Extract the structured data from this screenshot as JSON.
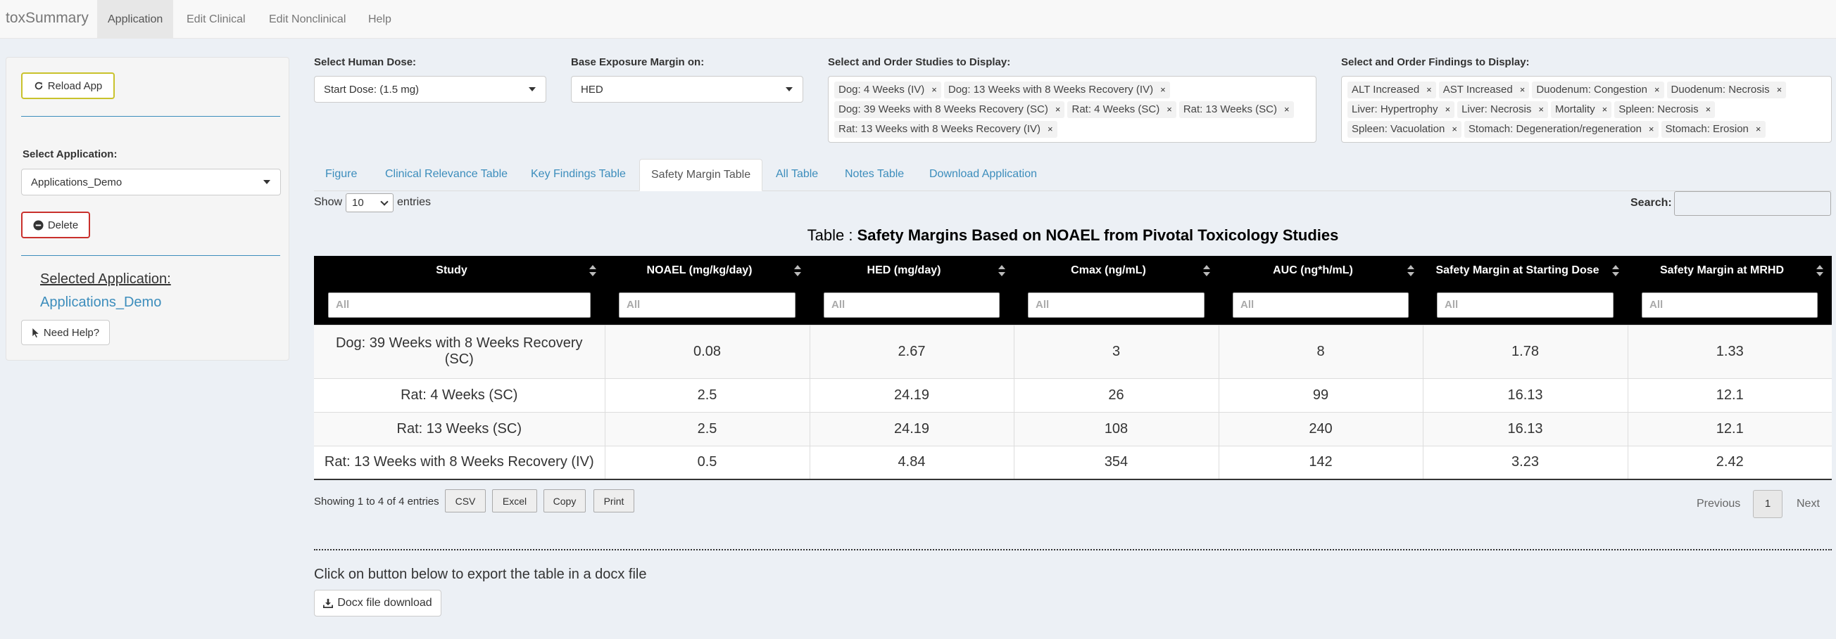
{
  "navbar": {
    "brand": "toxSummary",
    "items": [
      "Application",
      "Edit Clinical",
      "Edit Nonclinical",
      "Help"
    ]
  },
  "sidebar": {
    "reload_label": "Reload App",
    "select_application_label": "Select Application:",
    "application_value": "Applications_Demo",
    "delete_label": "Delete",
    "selected_title": "Selected Application:",
    "selected_value": "Applications_Demo",
    "help_label": "Need Help?"
  },
  "controls": {
    "human_dose_label": "Select Human Dose:",
    "human_dose_value": "Start Dose: (1.5 mg)",
    "base_label": "Base Exposure Margin on:",
    "base_value": "HED",
    "studies_label": "Select and Order Studies to Display:",
    "studies": [
      "Dog: 4 Weeks (IV)",
      "Dog: 13 Weeks with 8 Weeks Recovery (IV)",
      "Dog: 39 Weeks with 8 Weeks Recovery (SC)",
      "Rat: 4 Weeks (SC)",
      "Rat: 13 Weeks (SC)",
      "Rat: 13 Weeks with 8 Weeks Recovery (IV)"
    ],
    "findings_label": "Select and Order Findings to Display:",
    "findings": [
      "ALT Increased",
      "AST Increased",
      "Duodenum: Congestion",
      "Duodenum: Necrosis",
      "Liver: Hypertrophy",
      "Liver: Necrosis",
      "Mortality",
      "Spleen: Necrosis",
      "Spleen: Vacuolation",
      "Stomach: Degeneration/regeneration",
      "Stomach: Erosion"
    ]
  },
  "tabs": [
    "Figure",
    "Clinical Relevance Table",
    "Key Findings Table",
    "Safety Margin Table",
    "All Table",
    "Notes Table",
    "Download Application"
  ],
  "active_tab": "Safety Margin Table",
  "table_controls": {
    "show": "Show",
    "length": "10",
    "entries": "entries",
    "search_label": "Search:"
  },
  "caption": {
    "prefix": "Table : ",
    "title": "Safety Margins Based on NOAEL from Pivotal Toxicology Studies"
  },
  "table": {
    "columns": [
      "Study",
      "NOAEL (mg/kg/day)",
      "HED (mg/day)",
      "Cmax (ng/mL)",
      "AUC (ng*h/mL)",
      "Safety Margin at Starting Dose",
      "Safety Margin at MRHD"
    ],
    "filter_placeholder": "All",
    "rows": [
      [
        "Dog: 39 Weeks with 8 Weeks Recovery (SC)",
        "0.08",
        "2.67",
        "3",
        "8",
        "1.78",
        "1.33"
      ],
      [
        "Rat: 4 Weeks (SC)",
        "2.5",
        "24.19",
        "26",
        "99",
        "16.13",
        "12.1"
      ],
      [
        "Rat: 13 Weeks (SC)",
        "2.5",
        "24.19",
        "108",
        "240",
        "16.13",
        "12.1"
      ],
      [
        "Rat: 13 Weeks with 8 Weeks Recovery (IV)",
        "0.5",
        "4.84",
        "354",
        "142",
        "3.23",
        "2.42"
      ]
    ]
  },
  "footer": {
    "info": "Showing 1 to 4 of 4 entries",
    "buttons": [
      "CSV",
      "Excel",
      "Copy",
      "Print"
    ],
    "previous": "Previous",
    "page": "1",
    "next": "Next"
  },
  "export": {
    "text": "Click on button below to export the table in a docx file",
    "button": "Docx file download"
  }
}
